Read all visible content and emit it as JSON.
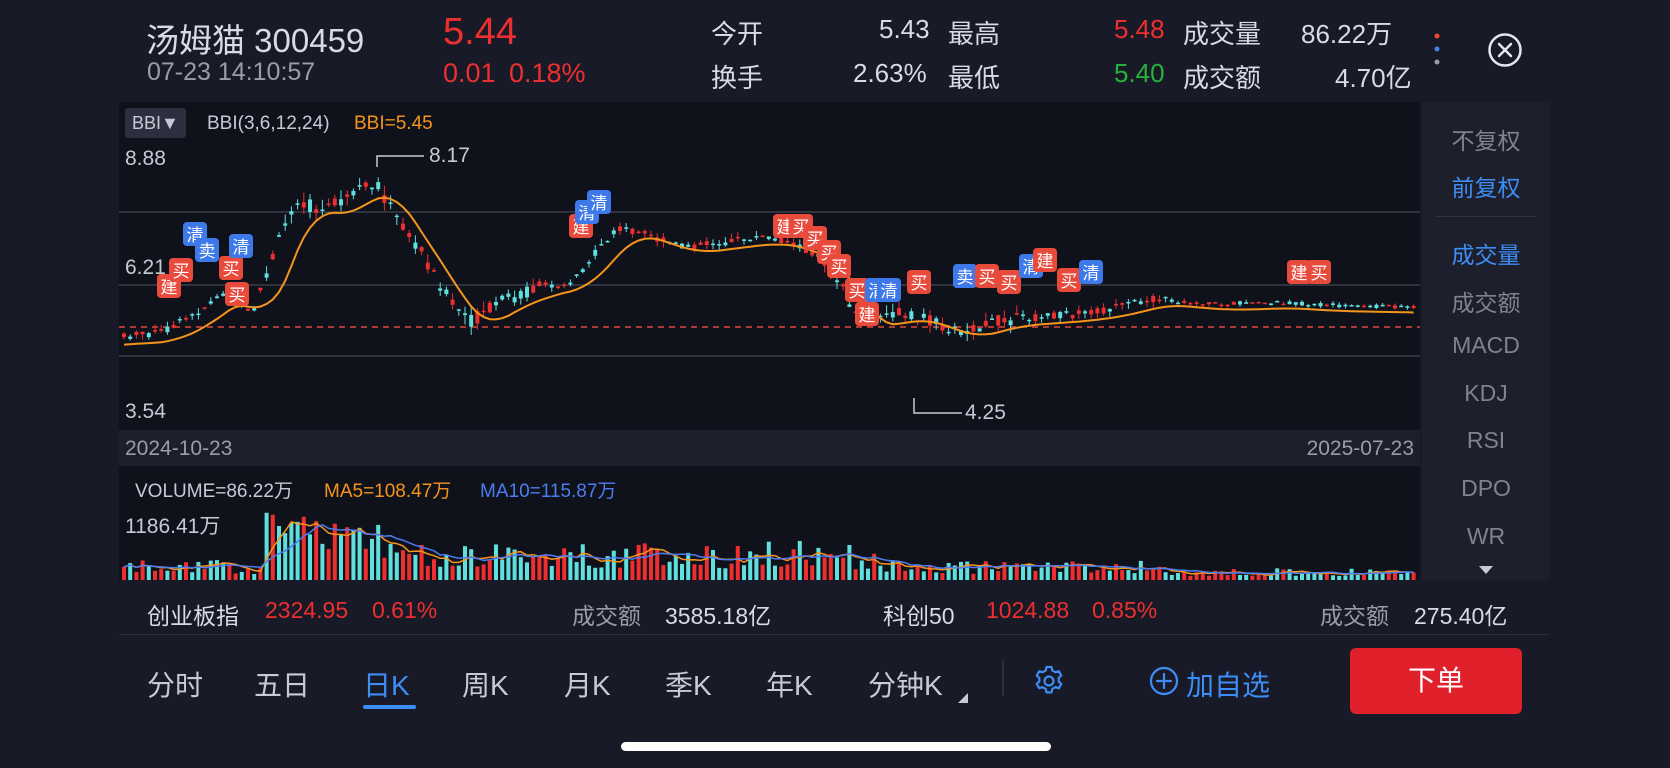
{
  "header": {
    "name": "汤姆猫 300459",
    "datetime": "07-23 14:10:57",
    "price": "5.44",
    "change": "0.01",
    "change_pct": "0.18%",
    "stats": {
      "open_label": "今开",
      "open_value": "5.43",
      "high_label": "最高",
      "high_value": "5.48",
      "volume_label": "成交量",
      "volume_value": "86.22万",
      "turnover_label": "换手",
      "turnover_value": "2.63%",
      "low_label": "最低",
      "low_value": "5.40",
      "amount_label": "成交额",
      "amount_value": "4.70亿"
    },
    "close_icon": "close-circle-icon",
    "more_icon": "vertical-dots-icon"
  },
  "indicator": {
    "select_label": "BBI▼",
    "params": "BBI(3,6,12,24)",
    "value": "BBI=5.45"
  },
  "axis": {
    "y_top": "8.88",
    "y_mid": "6.21",
    "y_bottom": "3.54",
    "max_label": "8.17",
    "min_label": "4.25",
    "date_start": "2024-10-23",
    "date_end": "2025-07-23"
  },
  "volume": {
    "label": "VOLUME=86.22万",
    "ma5": "MA5=108.47万",
    "ma10": "MA10=115.87万",
    "max_label": "1186.41万"
  },
  "side_menu": [
    {
      "label": "不复权",
      "active": false
    },
    {
      "label": "前复权",
      "active": true
    },
    {
      "label": "成交量",
      "active": true
    },
    {
      "label": "成交额",
      "active": false
    },
    {
      "label": "MACD",
      "active": false
    },
    {
      "label": "KDJ",
      "active": false
    },
    {
      "label": "RSI",
      "active": false
    },
    {
      "label": "DPO",
      "active": false
    },
    {
      "label": "WR",
      "active": false
    }
  ],
  "index_bar": {
    "chinext_name": "创业板指",
    "chinext_value": "2324.95",
    "chinext_pct": "0.61%",
    "chinext_amount_label": "成交额",
    "chinext_amount": "3585.18亿",
    "star_name": "科创50",
    "star_value": "1024.88",
    "star_pct": "0.85%",
    "star_amount_label": "成交额",
    "star_amount": "275.40亿"
  },
  "tabs": [
    {
      "label": "分时",
      "active": false
    },
    {
      "label": "五日",
      "active": false
    },
    {
      "label": "日K",
      "active": true
    },
    {
      "label": "周K",
      "active": false
    },
    {
      "label": "月K",
      "active": false
    },
    {
      "label": "季K",
      "active": false
    },
    {
      "label": "年K",
      "active": false
    },
    {
      "label": "分钟K",
      "active": false
    }
  ],
  "actions": {
    "settings_icon": "gear-icon",
    "add_watch_label": "加自选",
    "order_label": "下单"
  },
  "signals": [
    {
      "text": "建",
      "kind": "red"
    },
    {
      "text": "买",
      "kind": "red"
    },
    {
      "text": "清",
      "kind": "blue"
    },
    {
      "text": "卖",
      "kind": "blue"
    }
  ],
  "colors": {
    "up": "#ee2f2f",
    "down": "#5fe0df",
    "bbi": "#f5941d",
    "ma10": "#4c7cf0",
    "accent": "#3d8df5",
    "order": "#e0202a"
  }
}
